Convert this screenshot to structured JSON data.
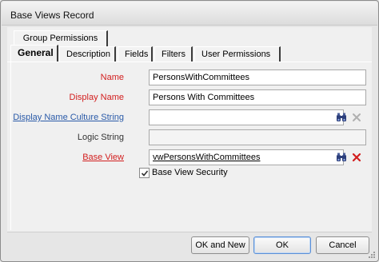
{
  "window": {
    "title": "Base Views Record"
  },
  "tabs": {
    "row1": [
      {
        "label": "Group Permissions"
      }
    ],
    "row2": [
      {
        "label": "General",
        "active": true
      },
      {
        "label": "Description"
      },
      {
        "label": "Fields"
      },
      {
        "label": "Filters"
      },
      {
        "label": "User Permissions"
      }
    ]
  },
  "form": {
    "name": {
      "label": "Name",
      "value": "PersonsWithCommittees"
    },
    "display_name": {
      "label": "Display Name",
      "value": "Persons With Committees"
    },
    "display_name_culture": {
      "label": "Display Name Culture String",
      "value": ""
    },
    "logic_string": {
      "label": "Logic String",
      "value": ""
    },
    "base_view": {
      "label": "Base View",
      "value": "vwPersonsWithCommittees"
    },
    "base_view_security": {
      "label": "Base View Security",
      "checked": true
    }
  },
  "buttons": {
    "ok_and_new": "OK and New",
    "ok": "OK",
    "cancel": "Cancel"
  },
  "colors": {
    "required_label": "#d21e1e",
    "link_label": "#2a5aa8"
  }
}
